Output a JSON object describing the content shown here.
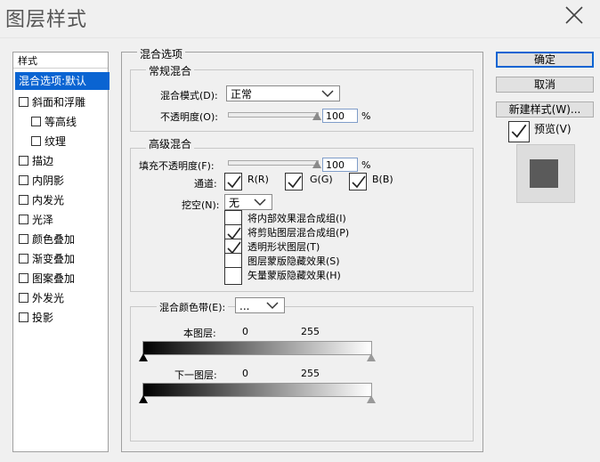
{
  "window": {
    "title": "图层样式"
  },
  "styles_list": {
    "header": "样式",
    "items": [
      {
        "label": "混合选项:默认",
        "selected": true,
        "checkbox": false,
        "indent": 0
      },
      {
        "label": "斜面和浮雕",
        "checkbox": true,
        "indent": 0
      },
      {
        "label": "等高线",
        "checkbox": true,
        "indent": 1
      },
      {
        "label": "纹理",
        "checkbox": true,
        "indent": 1
      },
      {
        "label": "描边",
        "checkbox": true,
        "indent": 0
      },
      {
        "label": "内阴影",
        "checkbox": true,
        "indent": 0
      },
      {
        "label": "内发光",
        "checkbox": true,
        "indent": 0
      },
      {
        "label": "光泽",
        "checkbox": true,
        "indent": 0
      },
      {
        "label": "颜色叠加",
        "checkbox": true,
        "indent": 0
      },
      {
        "label": "渐变叠加",
        "checkbox": true,
        "indent": 0
      },
      {
        "label": "图案叠加",
        "checkbox": true,
        "indent": 0
      },
      {
        "label": "外发光",
        "checkbox": true,
        "indent": 0
      },
      {
        "label": "投影",
        "checkbox": true,
        "indent": 0
      }
    ]
  },
  "blending": {
    "title": "混合选项",
    "general": {
      "title": "常规混合",
      "blend_mode_label": "混合模式(D):",
      "blend_mode_value": "正常",
      "opacity_label": "不透明度(O):",
      "opacity_value": "100",
      "opacity_unit": "%",
      "opacity_level": 100
    },
    "advanced": {
      "title": "高级混合",
      "fill_opacity_label": "填充不透明度(F):",
      "fill_opacity_value": "100",
      "fill_opacity_unit": "%",
      "fill_opacity_level": 100,
      "channels_label": "通道:",
      "channel_r": "R(R)",
      "channel_g": "G(G)",
      "channel_b": "B(B)",
      "knockout_label": "挖空(N):",
      "knockout_value": "无",
      "options": [
        {
          "label": "将内部效果混合成组(I)",
          "checked": false
        },
        {
          "label": "将剪贴图层混合成组(P)",
          "checked": true
        },
        {
          "label": "透明形状图层(T)",
          "checked": true
        },
        {
          "label": "图层蒙版隐藏效果(S)",
          "checked": false
        },
        {
          "label": "矢量蒙版隐藏效果(H)",
          "checked": false
        }
      ]
    },
    "blend_if": {
      "label": "混合颜色带(E):",
      "value": "...",
      "this_layer_label": "本图层:",
      "this_layer_min": "0",
      "this_layer_max": "255",
      "underlying_label": "下一图层:",
      "underlying_min": "0",
      "underlying_max": "255"
    }
  },
  "buttons": {
    "ok": "确定",
    "cancel": "取消",
    "new_style": "新建样式(W)...",
    "preview_label": "预览(V)",
    "preview_checked": true
  },
  "colors": {
    "selection": "#0a64d2",
    "preview_swatch": "#5a5a5a"
  }
}
